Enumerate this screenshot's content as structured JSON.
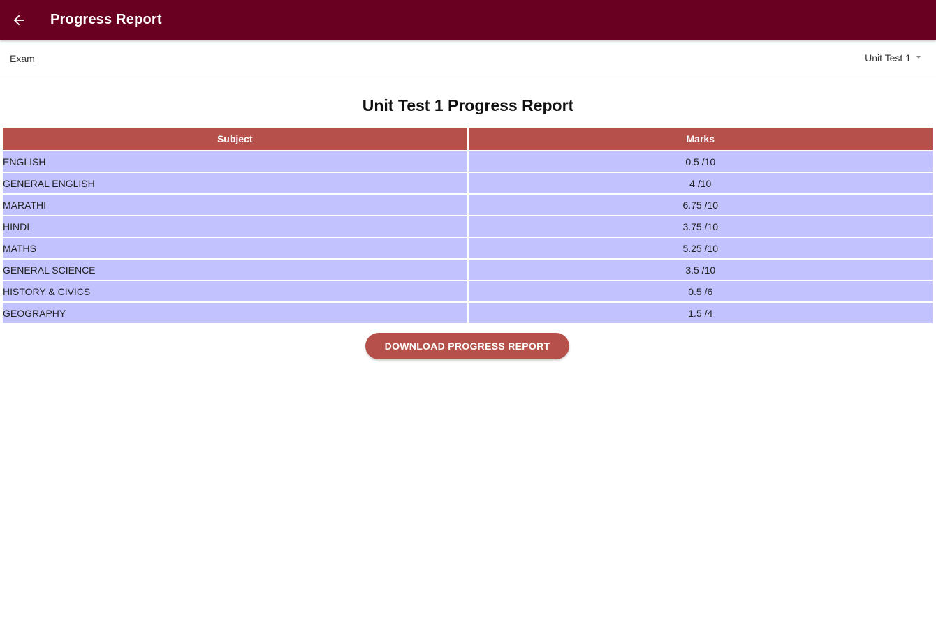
{
  "app_bar": {
    "title": "Progress Report",
    "back_icon": "arrow-left-icon",
    "color": "#6a0021"
  },
  "filter": {
    "label": "Exam",
    "selected": "Unit Test 1"
  },
  "report": {
    "title": "Unit Test 1 Progress Report",
    "headers": [
      "Subject",
      "Marks"
    ],
    "rows": [
      {
        "subject": "ENGLISH",
        "marks": "0.5 /10"
      },
      {
        "subject": "GENERAL ENGLISH",
        "marks": "4 /10"
      },
      {
        "subject": "MARATHI",
        "marks": "6.75 /10"
      },
      {
        "subject": "HINDI",
        "marks": "3.75 /10"
      },
      {
        "subject": "MATHS",
        "marks": "5.25 /10"
      },
      {
        "subject": "GENERAL SCIENCE",
        "marks": "3.5 /10"
      },
      {
        "subject": "HISTORY & CIVICS",
        "marks": "0.5 /6"
      },
      {
        "subject": "GEOGRAPHY",
        "marks": "1.5 /4"
      }
    ],
    "header_color": "#b5514a",
    "row_color": "#c2c2fe"
  },
  "download_button": {
    "label": "DOWNLOAD PROGRESS REPORT"
  }
}
